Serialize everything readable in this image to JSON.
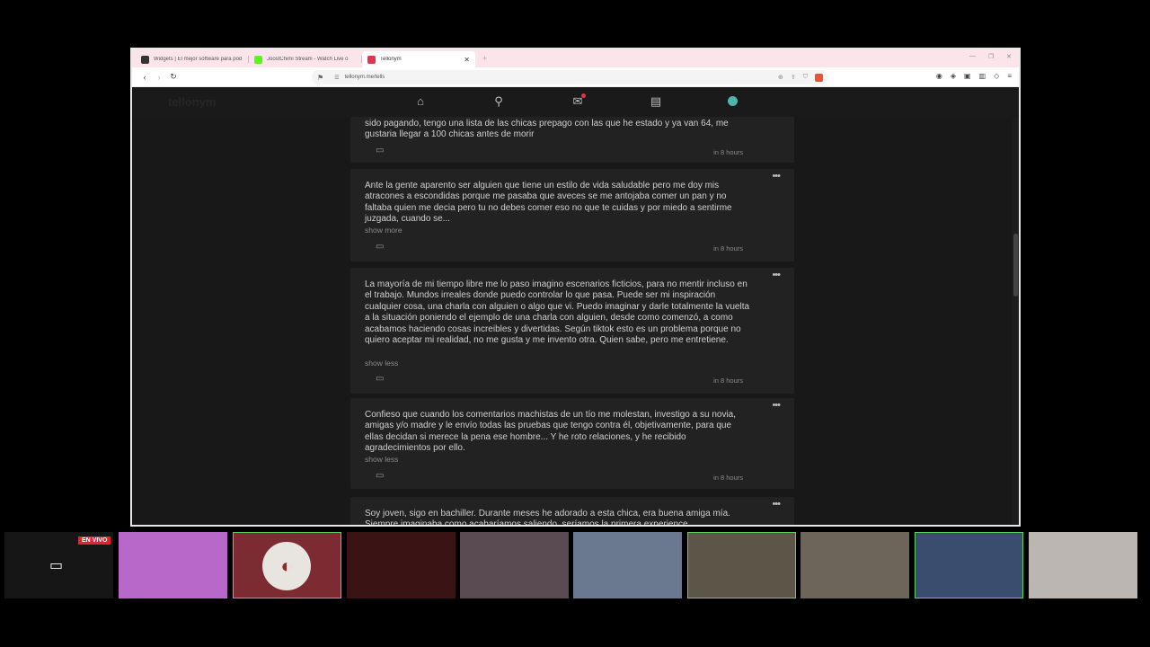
{
  "browser": {
    "tabs": [
      {
        "title": "Widgets | El mejor software para pod",
        "favicon_color": "#333333",
        "active": false
      },
      {
        "title": "JoostChimi Stream - Watch Live o",
        "favicon_color": "#53fc18",
        "active": false
      },
      {
        "title": "Tellonym",
        "favicon_color": "#e0364c",
        "active": true
      }
    ],
    "new_tab_label": "+",
    "url": "tellonym.me/tells"
  },
  "site": {
    "logo_text": "tellonym"
  },
  "feed": {
    "cards": [
      {
        "text": "sido pagando, tengo una lista de las chicas prepago con las que he estado y ya van 64, me gustaria llegar a 100 chicas antes de morir",
        "toggle": "",
        "time": "in 8 hours"
      },
      {
        "text": "Ante la gente aparento ser alguien que tiene un estilo de vida saludable pero me doy mis atracones a escondidas porque me pasaba que aveces se me antojaba comer un pan y no faltaba quien me decia pero tu no debes comer eso no que te cuidas y por miedo a sentirme juzgada, cuando se...",
        "toggle": "show more",
        "time": "in 8 hours"
      },
      {
        "text": "La mayoría de mi tiempo libre me lo paso imagino escenarios ficticios, para no mentir incluso en el trabajo. Mundos irreales donde puedo controlar lo que pasa. Puede ser mi inspiración cualquier cosa, una charla con alguien o algo que vi. Puedo imaginar y darle totalmente la vuelta a la situación poniendo el ejemplo de una charla con alguien, desde como comenzó, a como acabamos haciendo cosas increibles y divertidas. Según tiktok esto es un problema porque no quiero aceptar mi realidad, no me gusta y me invento otra. Quien sabe, pero me entretiene.",
        "toggle": "show less",
        "time": "in 8 hours"
      },
      {
        "text": "Confieso que cuando los comentarios machistas de un tío me molestan, investigo a su novia, amigas y/o madre y le envío todas las pruebas que tengo contra él, objetivamente, para que ellas decidan si merece la pena ese hombre... Y he roto relaciones, y he recibido agradecimientos por ello.",
        "toggle": "show less",
        "time": "in 8 hours"
      },
      {
        "text": "Soy joven, sigo en bachiller. Durante meses he adorado a esta chica, era buena amiga mía. Siempre imaginaba como acabaríamos saliendo, seríamos la primera experience",
        "toggle": "",
        "time": ""
      }
    ]
  },
  "streams": {
    "live_badge": "EN VIVO",
    "tiles": [
      {
        "name": "screen-share",
        "color": "#161616"
      },
      {
        "name": "streamer-2",
        "color": "#b868c8"
      },
      {
        "name": "streamer-3",
        "color": "#7c2b33"
      },
      {
        "name": "streamer-4",
        "color": "#3a1414"
      },
      {
        "name": "streamer-5",
        "color": "#5a4a52"
      },
      {
        "name": "streamer-6",
        "color": "#6a7890"
      },
      {
        "name": "streamer-7",
        "color": "#5c5648"
      },
      {
        "name": "streamer-8",
        "color": "#6e655a"
      },
      {
        "name": "streamer-9",
        "color": "#3b4d6e"
      },
      {
        "name": "streamer-10",
        "color": "#bcb6b2"
      }
    ]
  }
}
